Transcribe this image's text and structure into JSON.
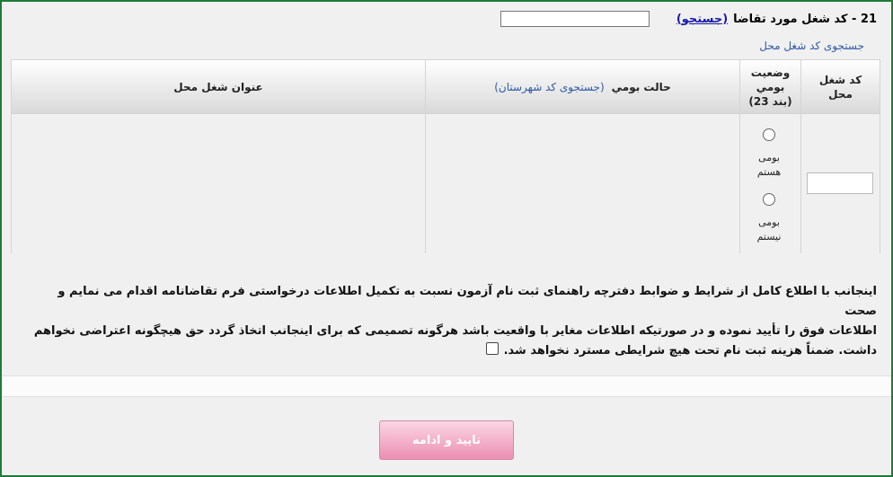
{
  "job": {
    "label": "21 - کد شغل مورد تقاضا",
    "search_link": "(جستجو)",
    "input_value": ""
  },
  "search_local_link": "جستجوی کد شغل محل",
  "table": {
    "headers": {
      "code": "کد شغل\nمحل",
      "status": "وضعيت\nبومي\n(بند 23)",
      "native": "حالت بومي",
      "native_link": "(جستجوی کد شهرستان)",
      "title": "عنوان شغل محل"
    },
    "radios": [
      {
        "label": "بومی\nهستم"
      },
      {
        "label": "بومی\nنیستم"
      }
    ]
  },
  "agreement": {
    "line1": "اینجانب با اطلاع کامل از شرایط و ضوابط دفترچه راهنمای ثبت نام آزمون نسبت به تکمیل اطلاعات درخواستی فرم تقاضانامه اقدام می نمایم و صحت",
    "line2": "اطلاعات فوق را تأیید نموده و در صورتیکه اطلاعات مغایر با واقعیت باشد هرگونه تصمیمی که برای اینجانب اتخاذ گردد حق هیچگونه اعتراضی نخواهم",
    "line3": "داشت. ضمناً هزینه ثبت نام تحت هیچ شرایطی مسترد نخواهد شد."
  },
  "submit_label": "تایید و ادامه"
}
